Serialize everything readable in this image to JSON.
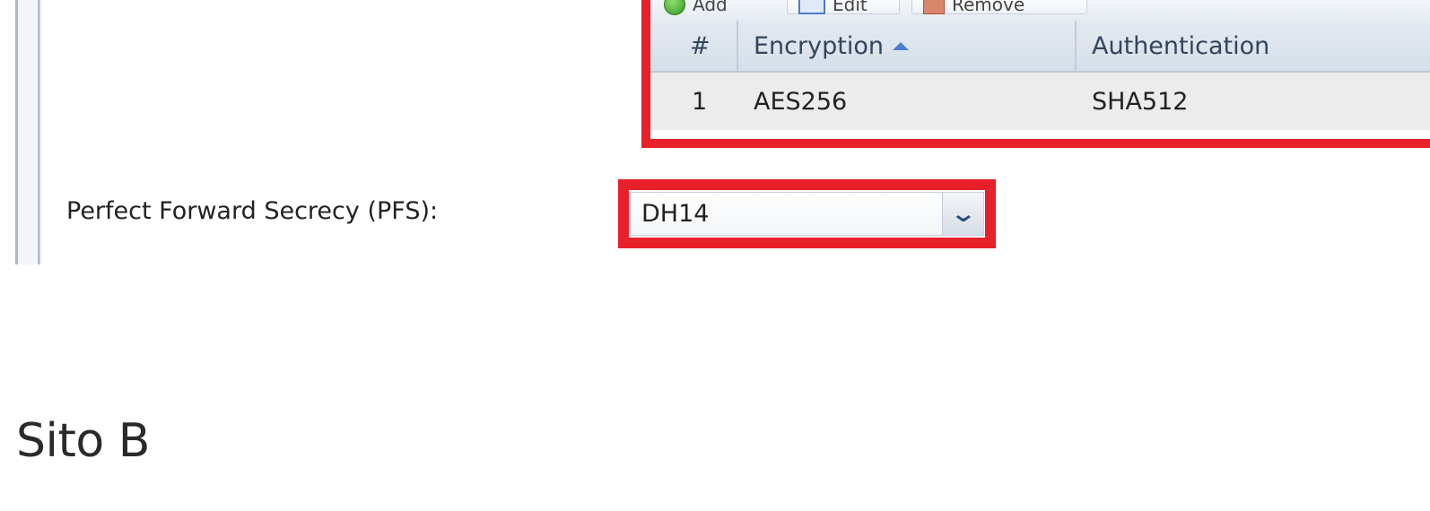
{
  "toolbar": {
    "add_label": "Add",
    "edit_label": "Edit",
    "remove_label": "Remove"
  },
  "table": {
    "headers": [
      "#",
      "Encryption",
      "Authentication"
    ],
    "sort_column": "Encryption",
    "sort_direction": "ascending",
    "rows": [
      [
        "1",
        "AES256",
        "SHA512"
      ]
    ]
  },
  "pfs": {
    "label": "Perfect Forward Secrecy (PFS):",
    "selected_value": "DH14"
  },
  "section": {
    "heading": "Sito B"
  },
  "colors": {
    "highlight": "#e8202a",
    "sort_arrow": "#4d7fd1"
  },
  "icons": {
    "add": "add-icon",
    "edit": "edit-icon",
    "remove": "remove-icon",
    "sort": "sort-ascending-icon",
    "dropdown": "chevron-down-icon"
  }
}
